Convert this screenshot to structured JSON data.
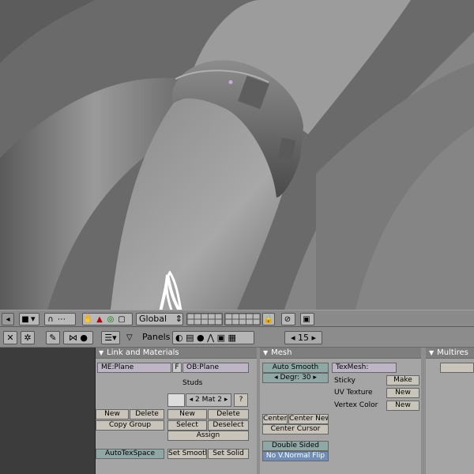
{
  "toolbar": {
    "orientation_select": "Global"
  },
  "buttons_header": {
    "panels_label": "Panels",
    "frame_number": "15"
  },
  "link_materials": {
    "title": "Link and Materials",
    "mesh_field": "ME:Plane",
    "f_label": "F",
    "object_field": "OB:Plane",
    "vertex_group": "Studs",
    "material_index": "2 Mat 2",
    "question": "?",
    "vgroup_new": "New",
    "vgroup_delete": "Delete",
    "copy_group": "Copy Group",
    "mat_new": "New",
    "mat_delete": "Delete",
    "select": "Select",
    "deselect": "Deselect",
    "assign": "Assign",
    "autotexspace": "AutoTexSpace",
    "set_smooth": "Set Smooth",
    "set_solid": "Set Solid"
  },
  "mesh": {
    "title": "Mesh",
    "auto_smooth": "Auto Smooth",
    "degr": "Degr: 30",
    "texmesh": "TexMesh:",
    "sticky": "Sticky",
    "sticky_make": "Make",
    "uv_texture": "UV Texture",
    "uv_new": "New",
    "vertex_color": "Vertex Color",
    "vc_new": "New",
    "center": "Center",
    "center_new": "Center New",
    "center_cursor": "Center Cursor",
    "double_sided": "Double Sided",
    "no_vnormal_flip": "No V.Normal Flip"
  },
  "multires": {
    "title": "Multires"
  }
}
